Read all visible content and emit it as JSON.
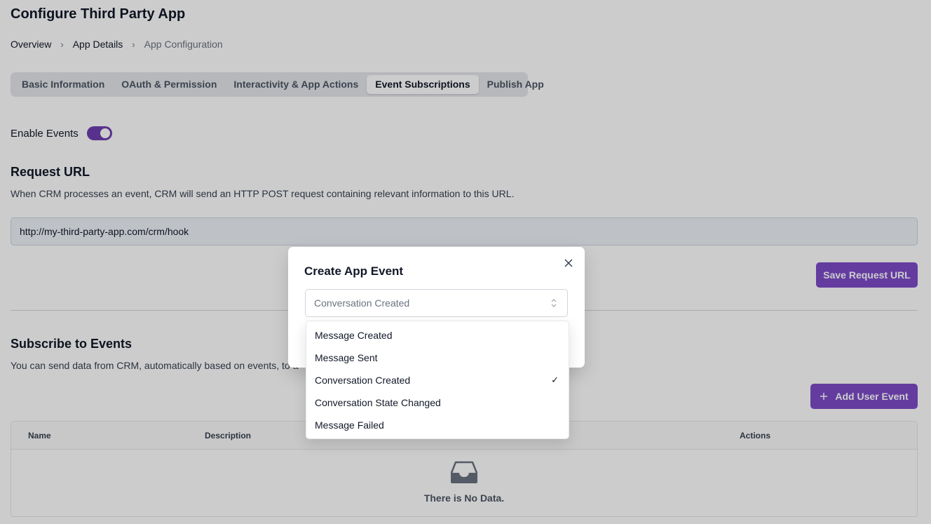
{
  "page": {
    "title": "Configure Third Party App"
  },
  "breadcrumb": {
    "items": [
      "Overview",
      "App Details",
      "App Configuration"
    ]
  },
  "tabs": [
    {
      "label": "Basic Information"
    },
    {
      "label": "OAuth & Permission"
    },
    {
      "label": "Interactivity & App Actions"
    },
    {
      "label": "Event Subscriptions",
      "active": true
    },
    {
      "label": "Publish App"
    }
  ],
  "events_toggle": {
    "label": "Enable Events",
    "enabled": true
  },
  "request_url": {
    "heading": "Request URL",
    "description": "When CRM processes an event, CRM will send an HTTP POST request containing relevant information to this URL.",
    "value": "http://my-third-party-app.com/crm/hook",
    "save_label": "Save Request URL"
  },
  "subscribe": {
    "heading": "Subscribe to Events",
    "description": "You can send data from CRM, automatically based on events, to a",
    "add_label": "Add User Event"
  },
  "table": {
    "columns": [
      "Name",
      "Description",
      "",
      "Actions"
    ],
    "empty_text": "There is No Data."
  },
  "modal": {
    "title": "Create App Event",
    "selected_value": "Conversation Created",
    "options": [
      {
        "label": "Message Created",
        "selected": false
      },
      {
        "label": "Message Sent",
        "selected": false
      },
      {
        "label": "Conversation Created",
        "selected": true
      },
      {
        "label": "Conversation State Changed",
        "selected": false
      },
      {
        "label": "Message Failed",
        "selected": false
      }
    ],
    "check_glyph": "✓"
  },
  "colors": {
    "accent": "#7e4cc9",
    "toggle_on": "#6d3fb0"
  }
}
